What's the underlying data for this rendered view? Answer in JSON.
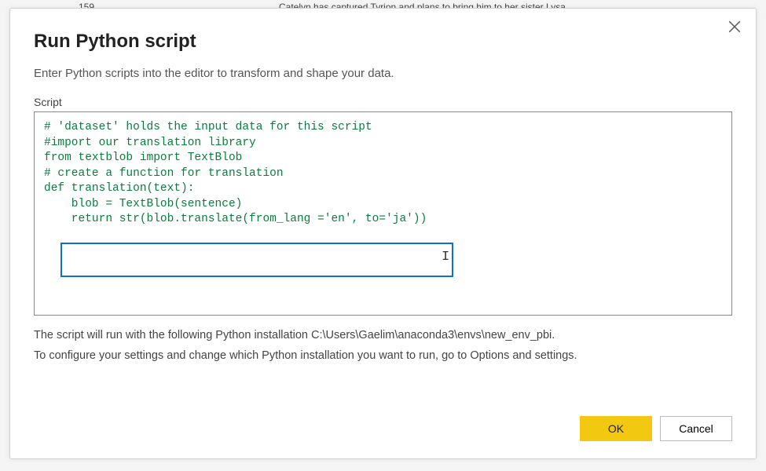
{
  "background": {
    "snippet": "Catelyn has captured Tyrion and plans to bring him to her sister Lysa",
    "number": "159"
  },
  "dialog": {
    "title": "Run Python script",
    "subtitle": "Enter Python scripts into the editor to transform and shape your data.",
    "script_label": "Script",
    "code": {
      "l1": "# 'dataset' holds the input data for this script",
      "l2": "",
      "l3": "#import our translation library",
      "l4": "from textblob import TextBlob",
      "l5": "",
      "l6": "# create a function for translation",
      "l7": "",
      "l8": "def translation(text):",
      "l9": "    blob = TextBlob(sentence)",
      "l10": "    return str(blob.translate(from_lang ='en', to='ja'))"
    },
    "footer1": "The script will run with the following Python installation C:\\Users\\Gaelim\\anaconda3\\envs\\new_env_pbi.",
    "footer2": "To configure your settings and change which Python installation you want to run, go to Options and settings.",
    "ok_label": "OK",
    "cancel_label": "Cancel"
  }
}
